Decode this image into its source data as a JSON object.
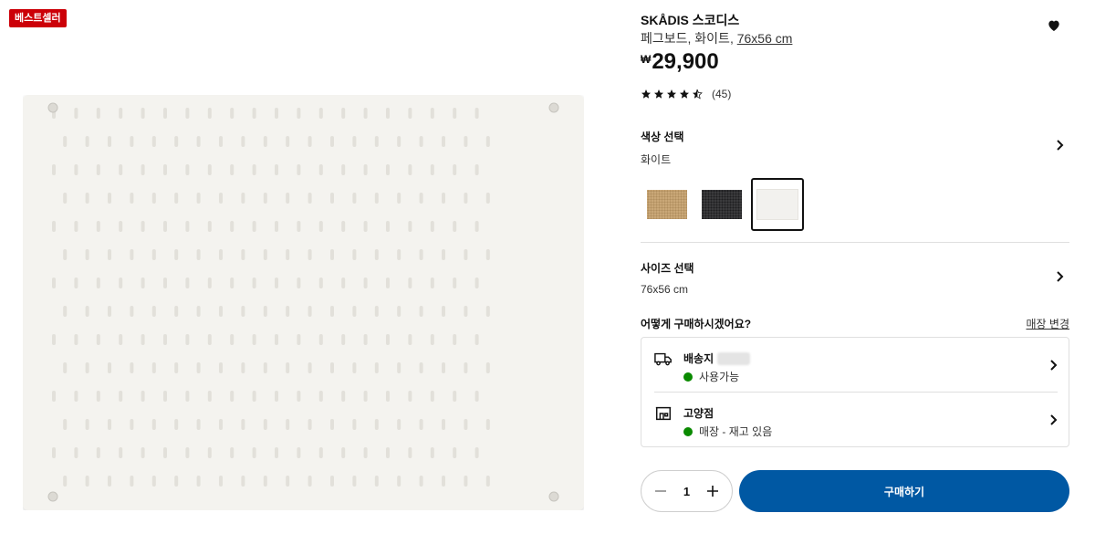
{
  "badge": "베스트셀러",
  "product": {
    "name": "SKÅDIS 스코디스",
    "description_prefix": "페그보드, 화이트, ",
    "size": "76x56 cm",
    "currency": "₩",
    "price": "29,900",
    "rating": 4.5,
    "review_count": "(45)"
  },
  "color": {
    "label": "색상 선택",
    "value": "화이트",
    "swatches": [
      {
        "name": "wood",
        "color": "#c9a777"
      },
      {
        "name": "anthracite",
        "color": "#3a3a3c"
      },
      {
        "name": "white",
        "color": "#f2f1ee",
        "selected": true
      }
    ]
  },
  "size": {
    "label": "사이즈 선택",
    "value": "76x56 cm"
  },
  "purchase": {
    "question": "어떻게 구매하시겠어요?",
    "change_store": "매장 변경",
    "delivery": {
      "label": "배송지",
      "status": "사용가능"
    },
    "store": {
      "label": "고양점",
      "status": "매장 - 재고 있음"
    }
  },
  "cart": {
    "quantity": "1",
    "buy_label": "구매하기"
  },
  "colors": {
    "accent": "#0058a3",
    "badge": "#cc0008",
    "available": "#0a8a00"
  }
}
